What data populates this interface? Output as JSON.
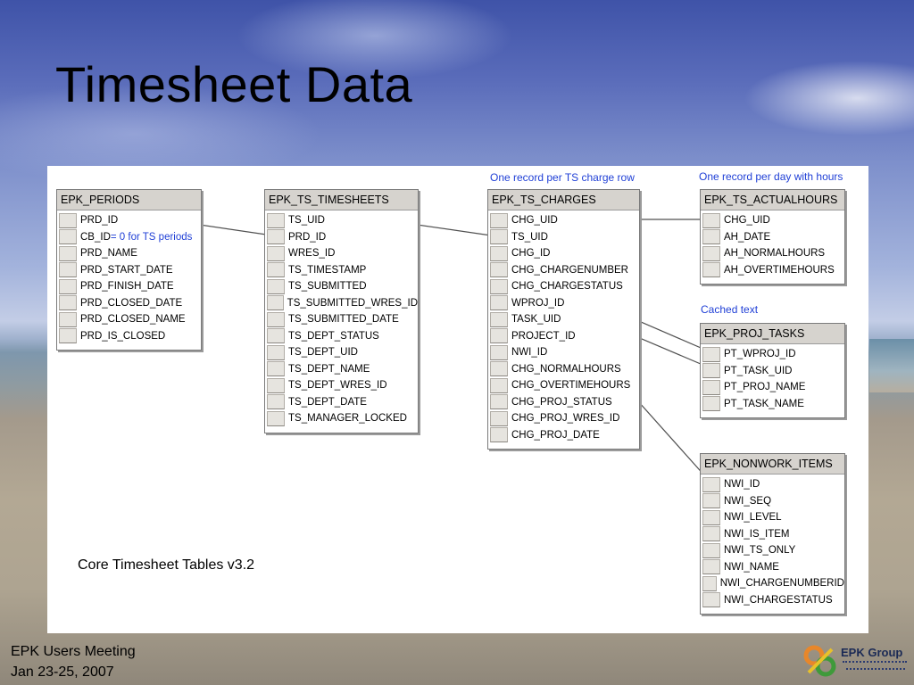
{
  "slide": {
    "title": "Timesheet Data",
    "footer_line1": "EPK Users Meeting",
    "footer_line2": "Jan 23-25, 2007",
    "logo_text": "EPK Group"
  },
  "diagram": {
    "caption": "Core Timesheet Tables v3.2",
    "notes": {
      "charges": "One record per TS charge row",
      "actualhours": "One record per day with hours",
      "proj_tasks": "Cached text"
    },
    "tables": {
      "periods": {
        "name": "EPK_PERIODS",
        "fields": [
          "PRD_ID",
          "CB_ID",
          "PRD_NAME",
          "PRD_START_DATE",
          "PRD_FINISH_DATE",
          "PRD_CLOSED_DATE",
          "PRD_CLOSED_NAME",
          "PRD_IS_CLOSED"
        ],
        "cb_id_note": " = 0 for TS periods"
      },
      "timesheets": {
        "name": "EPK_TS_TIMESHEETS",
        "fields": [
          "TS_UID",
          "PRD_ID",
          "WRES_ID",
          "TS_TIMESTAMP",
          "TS_SUBMITTED",
          "TS_SUBMITTED_WRES_ID",
          "TS_SUBMITTED_DATE",
          "TS_DEPT_STATUS",
          "TS_DEPT_UID",
          "TS_DEPT_NAME",
          "TS_DEPT_WRES_ID",
          "TS_DEPT_DATE",
          "TS_MANAGER_LOCKED"
        ]
      },
      "charges": {
        "name": "EPK_TS_CHARGES",
        "fields": [
          "CHG_UID",
          "TS_UID",
          "CHG_ID",
          "CHG_CHARGENUMBER",
          "CHG_CHARGESTATUS",
          "WPROJ_ID",
          "TASK_UID",
          "PROJECT_ID",
          "NWI_ID",
          "CHG_NORMALHOURS",
          "CHG_OVERTIMEHOURS",
          "CHG_PROJ_STATUS",
          "CHG_PROJ_WRES_ID",
          "CHG_PROJ_DATE"
        ]
      },
      "actualhours": {
        "name": "EPK_TS_ACTUALHOURS",
        "fields": [
          "CHG_UID",
          "AH_DATE",
          "AH_NORMALHOURS",
          "AH_OVERTIMEHOURS"
        ]
      },
      "proj_tasks": {
        "name": "EPK_PROJ_TASKS",
        "fields": [
          "PT_WPROJ_ID",
          "PT_TASK_UID",
          "PT_PROJ_NAME",
          "PT_TASK_NAME"
        ]
      },
      "nonwork": {
        "name": "EPK_NONWORK_ITEMS",
        "fields": [
          "NWI_ID",
          "NWI_SEQ",
          "NWI_LEVEL",
          "NWI_IS_ITEM",
          "NWI_TS_ONLY",
          "NWI_NAME",
          "NWI_CHARGENUMBERID",
          "NWI_CHARGESTATUS"
        ]
      }
    }
  },
  "colors": {
    "note_text": "#1f3fd6",
    "table_header": "#d6d3ce",
    "link_line": "#505050"
  }
}
